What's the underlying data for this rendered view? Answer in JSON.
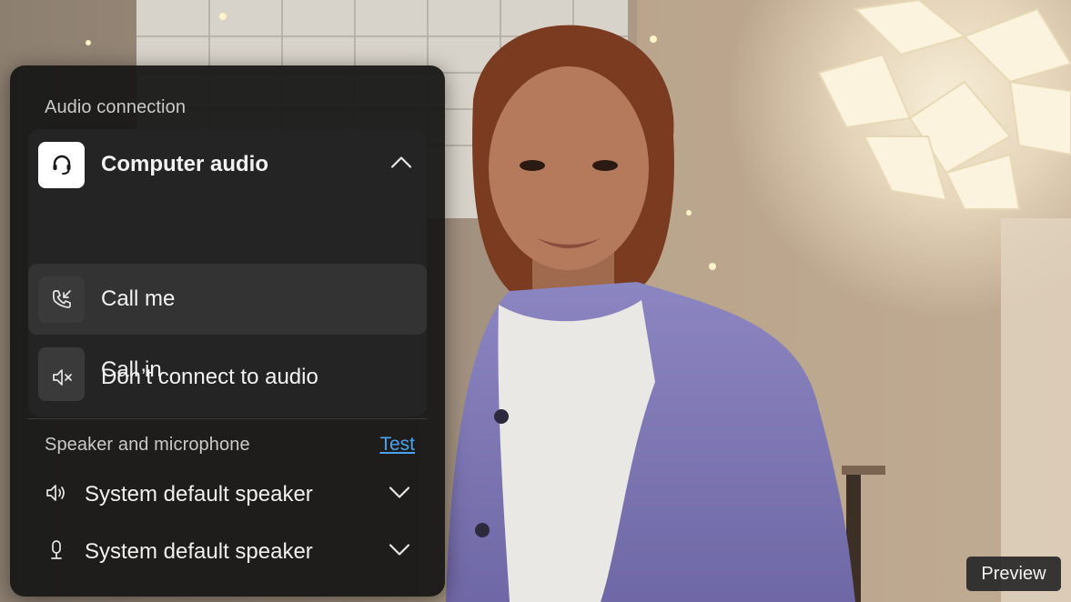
{
  "audio_section": {
    "title": "Audio connection",
    "options": [
      {
        "label": "Computer audio",
        "icon": "headset-icon",
        "selected": true,
        "expanded": true
      },
      {
        "label": "Call me",
        "icon": "phone-incoming-icon"
      },
      {
        "label": "Call in",
        "icon": "phone-outgoing-icon"
      },
      {
        "label": "Don’t connect to audio",
        "icon": "speaker-muted-icon"
      }
    ]
  },
  "device_section": {
    "title": "Speaker and microphone",
    "test_label": "Test",
    "speaker": {
      "label": "System default speaker",
      "icon": "speaker-icon"
    },
    "microphone": {
      "label": "System default speaker",
      "icon": "microphone-icon"
    }
  },
  "preview_badge": "Preview",
  "colors": {
    "panel_bg": "#161616",
    "card_bg": "#242424",
    "hover_bg": "#333333",
    "link": "#4aa3f0"
  }
}
